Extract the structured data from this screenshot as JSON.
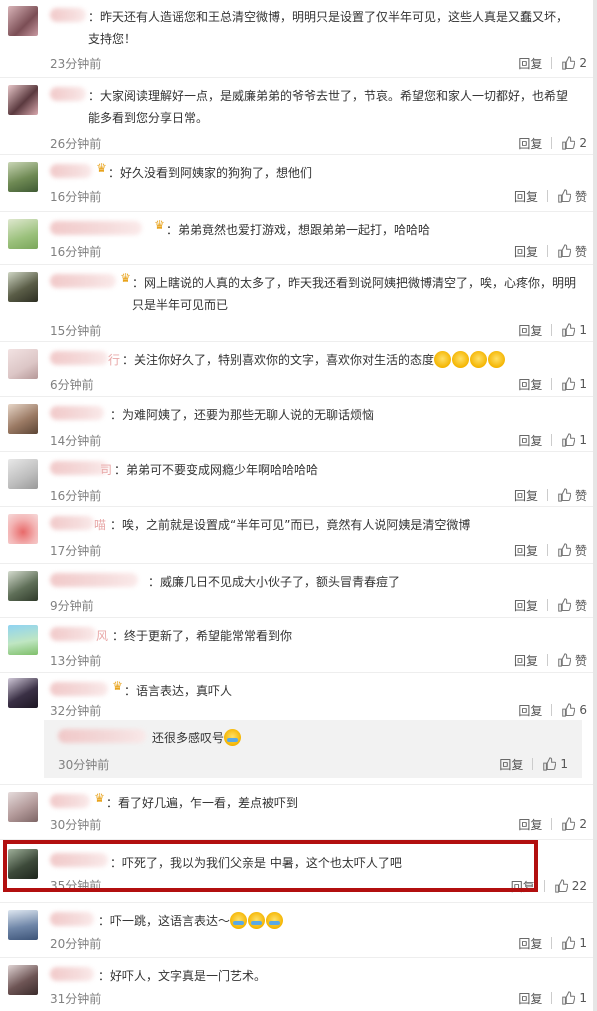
{
  "labels": {
    "reply": "回复",
    "like": "赞"
  },
  "comments": [
    {
      "text": "：昨天还有人造谣您和王总清空微博，明明只是设置了仅半年可见，这些人真是又蠢又坏，支持您！",
      "time": "23分钟前",
      "likes": "2"
    },
    {
      "text": "：大家阅读理解好一点，是威廉弟弟的爷爷去世了，节哀。希望您和家人一切都好，也希望能多看到您分享日常。",
      "time": "26分钟前",
      "likes": "2"
    },
    {
      "text": "：好久没看到阿姨家的狗狗了，想他们",
      "time": "16分钟前",
      "likes": "赞"
    },
    {
      "text": "：弟弟竟然也爱打游戏，想跟弟弟一起打，哈哈哈",
      "time": "16分钟前",
      "likes": "赞"
    },
    {
      "text": "：网上瞎说的人真的太多了，昨天我还看到说阿姨把微博清空了，唉，心疼你，明明只是半年可见而已",
      "time": "15分钟前",
      "likes": "1"
    },
    {
      "text": "：关注你好久了，特别喜欢你的文字，喜欢你对生活的态度",
      "time": "6分钟前",
      "likes": "1"
    },
    {
      "text": "：为难阿姨了，还要为那些无聊人说的无聊话烦恼",
      "time": "14分钟前",
      "likes": "1"
    },
    {
      "text": "：弟弟可不要变成网瘾少年啊哈哈哈哈",
      "time": "16分钟前",
      "likes": "赞"
    },
    {
      "text": "：唉，之前就是设置成“半年可见”而已，竟然有人说阿姨是清空微博",
      "time": "17分钟前",
      "likes": "赞"
    },
    {
      "text": "：威廉几日不见成大小伙子了，额头冒青春痘了",
      "time": "9分钟前",
      "likes": "赞"
    },
    {
      "text": "：终于更新了，希望能常常看到你",
      "time": "13分钟前",
      "likes": "赞"
    },
    {
      "text": "：语言表达，真吓人",
      "time": "32分钟前",
      "likes": "6"
    },
    {
      "text": "：看了好几遍，乍一看，差点被吓到",
      "time": "30分钟前",
      "likes": "2"
    },
    {
      "text": "：吓死了，我以为我们父亲是 中暑，这个也太吓人了吧",
      "time": "35分钟前",
      "likes": "22"
    },
    {
      "text": "：吓一跳，这语言表达～",
      "time": "20分钟前",
      "likes": "1"
    },
    {
      "text": "：好吓人，文字真是一门艺术。",
      "time": "31分钟前",
      "likes": "1"
    }
  ],
  "sub_reply": {
    "text": "还很多感叹号",
    "time": "30分钟前",
    "likes": "1"
  }
}
